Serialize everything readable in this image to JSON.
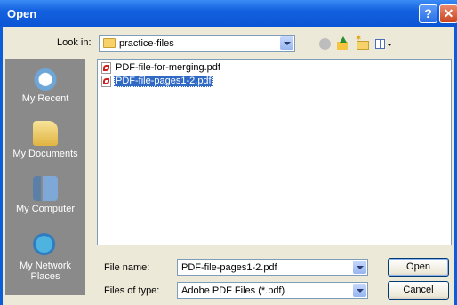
{
  "window": {
    "title": "Open",
    "help_label": "?",
    "close_label": "✕"
  },
  "toolbar": {
    "look_in_label": "Look in:",
    "look_in_value": "practice-files",
    "icons": [
      "back-icon",
      "up-folder-icon",
      "new-folder-icon",
      "views-menu-icon"
    ]
  },
  "places": [
    {
      "label": "My Recent",
      "icon": "recent-documents-icon"
    },
    {
      "label": "My Documents",
      "icon": "my-documents-icon"
    },
    {
      "label": "My Computer",
      "icon": "my-computer-icon"
    },
    {
      "label": "My Network Places",
      "icon": "network-places-icon"
    }
  ],
  "files": [
    {
      "name": "PDF-file-for-merging.pdf",
      "icon": "pdf-file-icon",
      "selected": false
    },
    {
      "name": "PDF-file-pages1-2.pdf",
      "icon": "pdf-file-icon",
      "selected": true
    }
  ],
  "form": {
    "file_name_label": "File name:",
    "file_name_value": "PDF-file-pages1-2.pdf",
    "file_type_label": "Files of type:",
    "file_type_value": "Adobe PDF Files (*.pdf)",
    "open_label": "Open",
    "cancel_label": "Cancel"
  },
  "colors": {
    "title_bar": "#0a5ddb",
    "dialog_bg": "#ece9d8",
    "selection": "#316ac5",
    "places_bar": "#8a8a8a"
  }
}
